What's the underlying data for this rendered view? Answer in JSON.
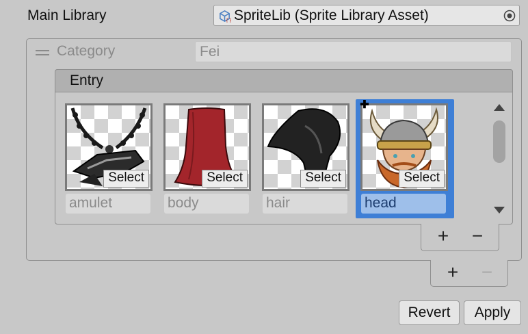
{
  "main_library": {
    "label": "Main Library",
    "value": "SpriteLib (Sprite Library Asset)",
    "icon": "sprite-library-asset-icon",
    "picker_icon": "object-picker-icon"
  },
  "category": {
    "label": "Category",
    "value": "Fei"
  },
  "entry": {
    "header": "Entry",
    "select_label": "Select",
    "items": [
      {
        "name": "amulet",
        "icon": "amulet-sprite",
        "selected": false
      },
      {
        "name": "body",
        "icon": "body-sprite",
        "selected": false
      },
      {
        "name": "hair",
        "icon": "hair-sprite",
        "selected": false
      },
      {
        "name": "head",
        "icon": "head-sprite",
        "selected": true
      }
    ],
    "add_label": "+",
    "remove_label": "−"
  },
  "category_controls": {
    "add_label": "+",
    "remove_label": "−"
  },
  "buttons": {
    "revert": "Revert",
    "apply": "Apply"
  },
  "colors": {
    "selection": "#3e7fd6",
    "body_red": "#a3252b",
    "background": "#c8c8c8"
  }
}
